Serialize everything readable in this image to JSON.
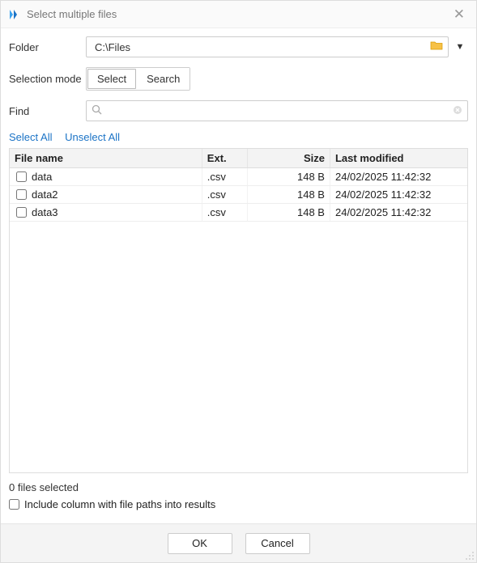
{
  "title": "Select multiple files",
  "labels": {
    "folder": "Folder",
    "selection_mode": "Selection mode",
    "find": "Find"
  },
  "folder": {
    "value": "C:\\Files",
    "placeholder": ""
  },
  "modes": {
    "select": "Select",
    "search": "Search",
    "active": "select"
  },
  "find": {
    "value": "",
    "placeholder": ""
  },
  "links": {
    "select_all": "Select All",
    "unselect_all": "Unselect All"
  },
  "columns": {
    "name": "File name",
    "ext": "Ext.",
    "size": "Size",
    "modified": "Last modified"
  },
  "rows": [
    {
      "checked": false,
      "name": "data",
      "ext": ".csv",
      "size": "148 B",
      "modified": "24/02/2025 11:42:32"
    },
    {
      "checked": false,
      "name": "data2",
      "ext": ".csv",
      "size": "148 B",
      "modified": "24/02/2025 11:42:32"
    },
    {
      "checked": false,
      "name": "data3",
      "ext": ".csv",
      "size": "148 B",
      "modified": "24/02/2025 11:42:32"
    }
  ],
  "status": "0 files selected",
  "include_paths": {
    "checked": false,
    "label": "Include column with file paths into results"
  },
  "buttons": {
    "ok": "OK",
    "cancel": "Cancel"
  }
}
